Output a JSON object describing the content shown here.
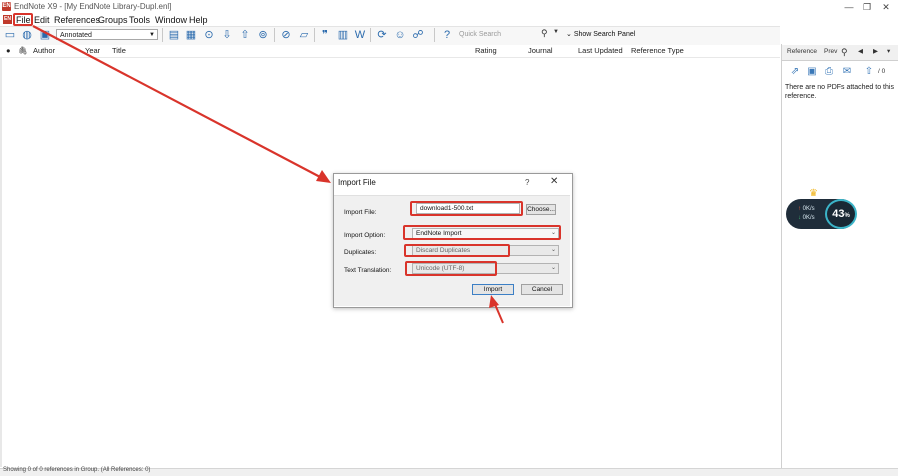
{
  "window": {
    "title": "EndNote X9 - [My EndNote Library-Dupl.enl]",
    "logo_text": "EN",
    "minimize": "—",
    "restore": "❐",
    "close": "✕"
  },
  "menu": {
    "logo_text": "EN",
    "items": [
      "File",
      "Edit",
      "References",
      "Groups",
      "Tools",
      "Window",
      "Help"
    ]
  },
  "toolbar": {
    "style_select_value": "Annotated",
    "quick_search_placeholder": "Quick Search",
    "show_search_panel": "Show Search Panel"
  },
  "columns": [
    "Author",
    "Year",
    "Title",
    "Rating",
    "Journal",
    "Last Updated",
    "Reference Type"
  ],
  "right_panel": {
    "tabs": [
      "Reference",
      "Prev"
    ],
    "page_count": "/ 0",
    "message": "There are no PDFs attached to this reference."
  },
  "speed_widget": {
    "percent": "43",
    "percent_suffix": "%",
    "up_rate": "0K/s",
    "down_rate": "0K/s"
  },
  "dialog": {
    "title": "Import File",
    "help": "?",
    "close": "✕",
    "fields": {
      "import_file_label": "Import File:",
      "import_file_value": "download1-500.txt",
      "choose_button": "Choose...",
      "import_option_label": "Import Option:",
      "import_option_value": "EndNote Import",
      "duplicates_label": "Duplicates:",
      "duplicates_value": "Discard Duplicates",
      "text_translation_label": "Text Translation:",
      "text_translation_value": "Unicode (UTF-8)"
    },
    "import_button": "Import",
    "cancel_button": "Cancel"
  },
  "status": {
    "text": "Showing 0 of 0 references in Group. (All References: 0)"
  },
  "colors": {
    "highlight": "#d9342b",
    "accent": "#2a6aad",
    "widget_ring": "#3bb4c8"
  }
}
